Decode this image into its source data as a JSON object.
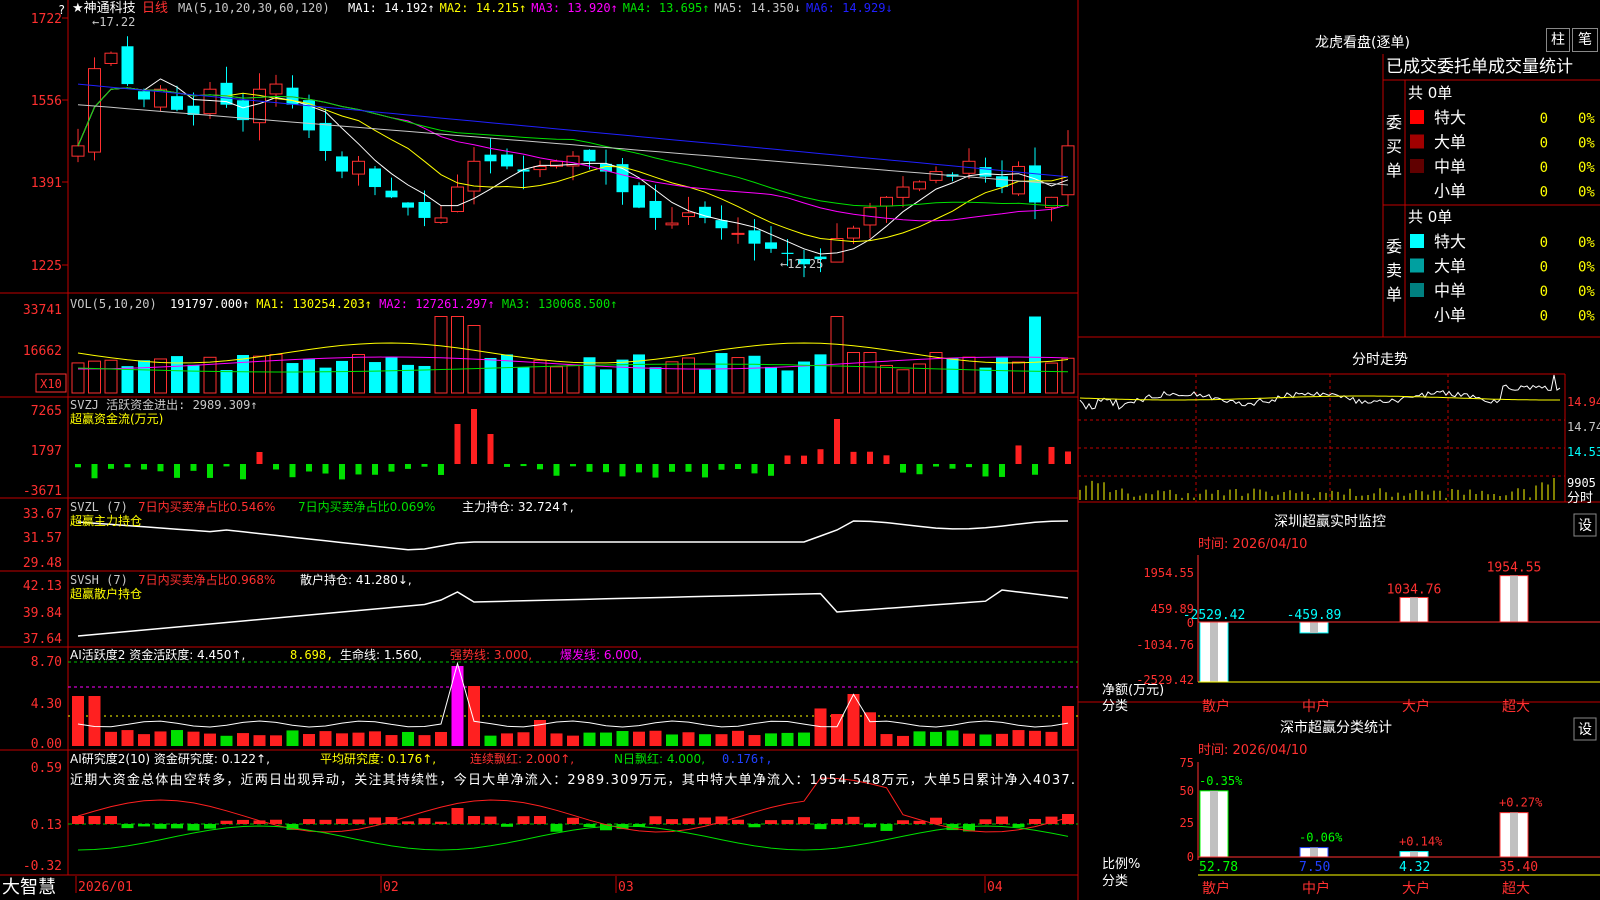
{
  "app": {
    "brand": "大智慧",
    "corner_mark": "?"
  },
  "main_chart": {
    "stock_name": "★神通科技",
    "period": "日线",
    "ma_label": "MA(5,10,20,30,60,120)",
    "ma_values": [
      {
        "label": "MA1: 14.192↑",
        "color": "#ffffff"
      },
      {
        "label": "MA2: 14.215↑",
        "color": "#ffff00"
      },
      {
        "label": "MA3: 13.920↑",
        "color": "#ff00ff"
      },
      {
        "label": "MA4: 13.695↑",
        "color": "#00e000"
      },
      {
        "label": "MA5: 14.350↓",
        "color": "#c8c8c8"
      },
      {
        "label": "MA6: 14.929↓",
        "color": "#2020ff"
      }
    ],
    "y_ticks": [
      "1722",
      "1556",
      "1391",
      "1225"
    ],
    "high_note": "←17.22",
    "low_note": "←12.25"
  },
  "vol_panel": {
    "label": "VOL(5,10,20)",
    "values": [
      {
        "label": "191797.000↑",
        "color": "#ffffff"
      },
      {
        "label": "MA1: 130254.203↑",
        "color": "#ffff00"
      },
      {
        "label": "MA2: 127261.297↑",
        "color": "#ff00ff"
      },
      {
        "label": "MA3: 130068.500↑",
        "color": "#00e000"
      }
    ],
    "y_ticks": [
      "33741",
      "16662"
    ],
    "unit": "X10"
  },
  "svzj_panel": {
    "label": "SVZJ  活跃资金进出: 2989.309↑",
    "subtitle": "超赢资金流(万元)",
    "y_ticks": [
      "7265",
      "1797",
      "-3671"
    ]
  },
  "svzl_panel": {
    "label": "SVZL (7)",
    "text1": "7日内买卖净占比0.546%",
    "text2": "7日内买卖净占比0.069%",
    "text3": "主力持仓: 32.724↑,",
    "subtitle": "超赢主力持仓",
    "y_ticks": [
      "33.67",
      "31.57",
      "29.48"
    ]
  },
  "svsh_panel": {
    "label": "SVSH (7)",
    "text1": "7日内买卖净占比0.968%",
    "text2": "散户持仓: 41.280↓,",
    "subtitle": "超赢散户持仓",
    "y_ticks": [
      "42.13",
      "39.84",
      "37.64"
    ]
  },
  "ai_active_panel": {
    "label": "AI活跃度2 资金活跃度: 4.450↑,",
    "v2": "8.698,",
    "v3": "生命线: 1.560,",
    "v4": "强势线: 3.000,",
    "v5": "爆发线: 6.000,",
    "y_ticks": [
      "8.70",
      "4.30",
      "0.00"
    ]
  },
  "ai_research_panel": {
    "label": "AI研究度2(10) 资金研究度: 0.122↑,",
    "v2": "平均研究度: 0.176↑,",
    "v3": "连续飘红: 2.000↑,",
    "v4": "N日飘红: 4.000,",
    "v5": "0.176↑,",
    "comment": "近期大资金总体由空转多，近两日出现异动，关注其持续性，今日大单净流入：2989.309万元，其中特大单净流入：1954.548万元，大单5日累计净入4037.",
    "y_ticks": [
      "0.59",
      "0.13",
      "-0.32"
    ]
  },
  "date_axis": [
    "2026/01",
    "02",
    "03",
    "04"
  ],
  "dragon": {
    "title": "龙虎看盘(逐单)",
    "btn1": "柱",
    "btn2": "笔",
    "header": "已成交委托单成交量统计",
    "buy_label": "委买单",
    "sell_label": "委卖单",
    "buy_total": "共 0单",
    "sell_total": "共 0单",
    "buy_rows": [
      {
        "name": "特大",
        "count": "0",
        "pct": "0%",
        "color": "#ff0000"
      },
      {
        "name": "大单",
        "count": "0",
        "pct": "0%",
        "color": "#a00000"
      },
      {
        "name": "中单",
        "count": "0",
        "pct": "0%",
        "color": "#600000"
      },
      {
        "name": "小单",
        "count": "0",
        "pct": "0%",
        "color": "#000000"
      }
    ],
    "sell_rows": [
      {
        "name": "特大",
        "count": "0",
        "pct": "0%",
        "color": "#00ffff"
      },
      {
        "name": "大单",
        "count": "0",
        "pct": "0%",
        "color": "#00a0a0"
      },
      {
        "name": "中单",
        "count": "0",
        "pct": "0%",
        "color": "#008080"
      },
      {
        "name": "小单",
        "count": "0",
        "pct": "0%",
        "color": "#000000"
      }
    ]
  },
  "intraday": {
    "title": "分时走势",
    "y_ticks": [
      "14.94",
      "14.74",
      "14.53"
    ],
    "vol_label": "9905",
    "unit_label": "分时"
  },
  "monitor": {
    "title": "深圳超赢实时监控",
    "set_btn": "设",
    "time": "时间: 2026/04/10",
    "y_ticks": [
      "1954.55",
      "459.89",
      "0",
      "-1034.76",
      "-2529.42"
    ],
    "ylabel": "净额(万元)",
    "xlabel_title": "分类",
    "categories": [
      "散户",
      "中户",
      "大户",
      "超大"
    ],
    "values": [
      -2529.42,
      -459.89,
      1034.76,
      1954.55
    ],
    "value_labels": [
      "-2529.42",
      "-459.89",
      "1034.76",
      "1954.55"
    ]
  },
  "classify": {
    "title": "深市超赢分类统计",
    "set_btn": "设",
    "time": "时间: 2026/04/10",
    "y_ticks": [
      "75",
      "50",
      "25",
      "0"
    ],
    "ylabel": "比例%",
    "xlabel_title": "分类",
    "categories": [
      "散户",
      "中户",
      "大户",
      "超大"
    ],
    "values": [
      52.78,
      7.5,
      4.32,
      35.4
    ],
    "value_labels": [
      "52.78",
      "7.50",
      "4.32",
      "35.40"
    ],
    "changes": [
      "-0.35%",
      "-0.06%",
      "+0.14%",
      "+0.27%"
    ],
    "change_colors": [
      "#00ff00",
      "#00ff00",
      "#ff3030",
      "#ff3030"
    ]
  }
}
